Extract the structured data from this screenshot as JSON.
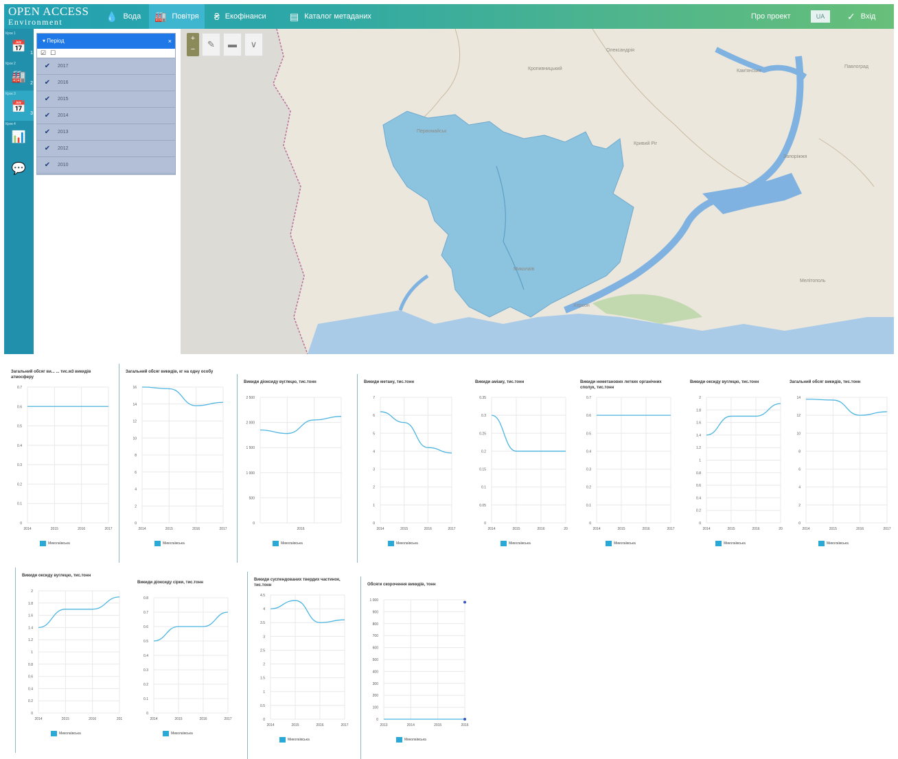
{
  "topbar": {
    "logo_line1": "OPEN ACCESS",
    "logo_line2": "Environment",
    "nav": [
      {
        "label": "Вода",
        "icon": "water-drop-icon"
      },
      {
        "label": "Повітря",
        "icon": "factory-icon"
      },
      {
        "label": "Екофінанси",
        "icon": "hryvnia-icon"
      },
      {
        "label": "Каталог метаданих",
        "icon": "catalog-icon"
      }
    ],
    "about": "Про проект",
    "lang": "UA",
    "login": "Вхід"
  },
  "rail": {
    "items": [
      {
        "tag": "Крок 1",
        "icon": "calendar-icon",
        "num": "1"
      },
      {
        "tag": "Крок 2",
        "icon": "factory-icon",
        "num": "2"
      },
      {
        "tag": "Крок 3",
        "icon": "calendar-icon",
        "num": "3"
      },
      {
        "tag": "Крок 4",
        "icon": "bar-chart-icon",
        "num": ""
      },
      {
        "tag": "",
        "icon": "comment-icon",
        "num": ""
      }
    ]
  },
  "period_panel": {
    "title": "Період",
    "years": [
      "2017",
      "2016",
      "2015",
      "2014",
      "2013",
      "2012",
      "2010"
    ]
  },
  "map": {
    "labels": [
      {
        "text": "Олександрія"
      },
      {
        "text": "Кропивницький"
      },
      {
        "text": "Кам'янське"
      },
      {
        "text": "Павлоград"
      },
      {
        "text": "Первомайськ"
      },
      {
        "text": "Кривий Ріг"
      },
      {
        "text": "Запоріжжя"
      },
      {
        "text": "Миколаїв"
      },
      {
        "text": "Херсон"
      },
      {
        "text": "Мелітополь"
      }
    ]
  },
  "legend_label": "Миколаївська",
  "charts": [
    {
      "id": "c1",
      "title": "Загальний обсяг ви... ... тис.м3 викидів атмосферу",
      "x": [
        "2014",
        "2015",
        "2016",
        "2017"
      ],
      "yticks": [
        "0",
        "0.1",
        "0.2",
        "0.3",
        "0.4",
        "0.5",
        "0.6",
        "0.7"
      ],
      "ymax": 0.7,
      "series_y": [
        0.6,
        0.6,
        0.6,
        0.6
      ]
    },
    {
      "id": "c2",
      "title": "Загальний обсяг викидів, кг на одну особу",
      "x": [
        "2014",
        "2015",
        "2016",
        "2017"
      ],
      "yticks": [
        "0",
        "2",
        "4",
        "6",
        "8",
        "10",
        "12",
        "14",
        "16"
      ],
      "ymax": 16,
      "series_y": [
        16,
        15.8,
        13.8,
        14.2
      ]
    },
    {
      "id": "c3",
      "title": "Викиди діоксиду вуглецю, тис.тонн",
      "x": [
        "2016"
      ],
      "yticks": [
        "0",
        "500",
        "1 000",
        "1 500",
        "2 000",
        "2 500"
      ],
      "ymax": 2500,
      "series_y": [
        1850,
        1780,
        2050,
        2120
      ]
    },
    {
      "id": "c4",
      "title": "Викиди метану, тис.тонн",
      "x": [
        "2014",
        "2015",
        "2016",
        "2017"
      ],
      "yticks": [
        "0",
        "1",
        "2",
        "3",
        "4",
        "5",
        "6",
        "7"
      ],
      "ymax": 7,
      "series_y": [
        6.2,
        5.6,
        4.2,
        3.9
      ]
    },
    {
      "id": "c5",
      "title": "Викиди аміаку, тис.тонн",
      "x": [
        "2014",
        "2015",
        "2016",
        "20"
      ],
      "yticks": [
        "0",
        "0.05",
        "0.1",
        "0.15",
        "0.2",
        "0.25",
        "0.3",
        "0.35"
      ],
      "ymax": 0.35,
      "series_y": [
        0.3,
        0.2,
        0.2,
        0.2
      ]
    },
    {
      "id": "c6",
      "title": "Викиди неметанових летких органічних сполук, тис.тонн",
      "x": [
        "2014",
        "2015",
        "2016",
        "2017"
      ],
      "yticks": [
        "0",
        "0.1",
        "0.2",
        "0.3",
        "0.4",
        "0.5",
        "0.6",
        "0.7"
      ],
      "ymax": 0.7,
      "series_y": [
        0.6,
        0.6,
        0.6,
        0.6
      ]
    },
    {
      "id": "c7",
      "title": "Викиди оксиду вуглецю, тис.тонн",
      "x": [
        "2014",
        "2015",
        "2016",
        "20"
      ],
      "yticks": [
        "0",
        "0.2",
        "0.4",
        "0.6",
        "0.8",
        "1",
        "1.2",
        "1.4",
        "1.6",
        "1.8",
        "2"
      ],
      "ymax": 2,
      "series_y": [
        1.4,
        1.7,
        1.7,
        1.9
      ]
    },
    {
      "id": "c8",
      "title": "Загальний обсяг викидів, тис.тонн",
      "x": [
        "2014",
        "2015",
        "2016",
        "2017"
      ],
      "yticks": [
        "0",
        "2",
        "4",
        "6",
        "8",
        "10",
        "12",
        "14"
      ],
      "ymax": 14,
      "series_y": [
        13.8,
        13.7,
        12.0,
        12.4
      ]
    },
    {
      "id": "c9",
      "title": "Викиди оксиду вуглецю, тис.тонн",
      "x": [
        "2014",
        "2015",
        "2016",
        "201"
      ],
      "yticks": [
        "0",
        "0.2",
        "0.4",
        "0.6",
        "0.8",
        "1",
        "1.2",
        "1.4",
        "1.6",
        "1.8",
        "2"
      ],
      "ymax": 2,
      "series_y": [
        1.4,
        1.7,
        1.7,
        1.9
      ]
    },
    {
      "id": "c10",
      "title": "Викиди діоксиду сірки, тис.тонн",
      "x": [
        "2014",
        "2015",
        "2016",
        "2017"
      ],
      "yticks": [
        "0",
        "0.1",
        "0.2",
        "0.3",
        "0.4",
        "0.5",
        "0.6",
        "0.7",
        "0.8"
      ],
      "ymax": 0.8,
      "series_y": [
        0.5,
        0.6,
        0.6,
        0.7
      ]
    },
    {
      "id": "c11",
      "title": "Викиди суспендованих твердих частинок, тис.тонн",
      "x": [
        "2014",
        "2015",
        "2016",
        "2017"
      ],
      "yticks": [
        "0",
        "0.5",
        "1",
        "1.5",
        "2",
        "2.5",
        "3",
        "3.5",
        "4",
        "4.5"
      ],
      "ymax": 4.5,
      "series_y": [
        4.0,
        4.3,
        3.5,
        3.6
      ]
    },
    {
      "id": "c12",
      "title": "Обсяги скорочення викидів, тонн",
      "x": [
        "2013",
        "2014",
        "2015",
        "2016"
      ],
      "yticks": [
        "0",
        "100",
        "200",
        "300",
        "400",
        "500",
        "600",
        "700",
        "800",
        "900",
        "1 000"
      ],
      "ymax": 1000,
      "series_y": [
        0,
        0,
        0,
        0
      ],
      "points": [
        [
          3,
          0
        ],
        [
          3,
          980
        ]
      ]
    }
  ]
}
